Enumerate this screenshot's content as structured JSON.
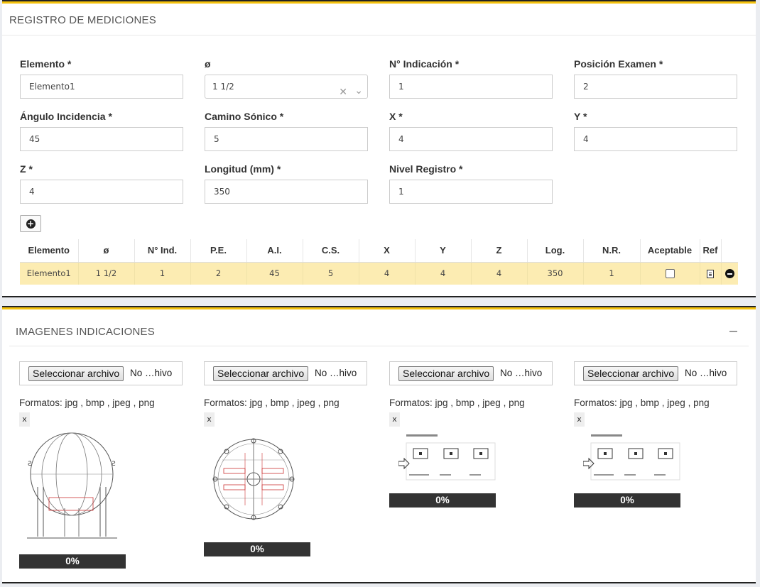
{
  "registro": {
    "title": "REGISTRO DE MEDICIONES",
    "fields": {
      "elemento": {
        "label": "Elemento *",
        "value": "Elemento1"
      },
      "diametro": {
        "label": "ø",
        "value": "1 1/2"
      },
      "n_indicacion": {
        "label": "N° Indicación *",
        "value": "1"
      },
      "posicion_examen": {
        "label": "Posición Examen *",
        "value": "2"
      },
      "angulo_incidencia": {
        "label": "Ángulo Incidencia *",
        "value": "45"
      },
      "camino_sonico": {
        "label": "Camino Sónico *",
        "value": "5"
      },
      "x": {
        "label": "X *",
        "value": "4"
      },
      "y": {
        "label": "Y *",
        "value": "4"
      },
      "z": {
        "label": "Z *",
        "value": "4"
      },
      "longitud": {
        "label": "Longitud (mm) *",
        "value": "350"
      },
      "nivel_registro": {
        "label": "Nivel Registro *",
        "value": "1"
      }
    },
    "table": {
      "headers": [
        "Elemento",
        "ø",
        "N° Ind.",
        "P.E.",
        "A.I.",
        "C.S.",
        "X",
        "Y",
        "Z",
        "Log.",
        "N.R.",
        "Aceptable",
        "Ref",
        ""
      ],
      "rows": [
        {
          "elemento": "Elemento1",
          "diametro": "1 1/2",
          "n_ind": "1",
          "pe": "2",
          "ai": "45",
          "cs": "5",
          "x": "4",
          "y": "4",
          "z": "4",
          "log": "350",
          "nr": "1",
          "aceptable": false
        }
      ]
    }
  },
  "imagenes": {
    "title": "IMAGENES INDICACIONES",
    "uploads": [
      {
        "button": "Seleccionar archivo",
        "file_text": "No …hivo",
        "formats": "Formatos: jpg , bmp , jpeg , png",
        "remove": "x",
        "progress_text": "0%",
        "progress": 0,
        "thumb": "spherical-tank-drawing"
      },
      {
        "button": "Seleccionar archivo",
        "file_text": "No …hivo",
        "formats": "Formatos: jpg , bmp , jpeg , png",
        "remove": "x",
        "progress_text": "0%",
        "progress": 0,
        "thumb": "sphere-weld-map-drawing"
      },
      {
        "button": "Seleccionar archivo",
        "file_text": "No …hivo",
        "formats": "Formatos: jpg , bmp , jpeg , png",
        "remove": "x",
        "progress_text": "0%",
        "progress": 0,
        "thumb": "products-ordered-screenshot"
      },
      {
        "button": "Seleccionar archivo",
        "file_text": "No …hivo",
        "formats": "Formatos: jpg , bmp , jpeg , png",
        "remove": "x",
        "progress_text": "0%",
        "progress": 0,
        "thumb": "products-ordered-screenshot"
      }
    ]
  },
  "colors": {
    "accent": "#f4c20d",
    "row_highlight": "#fcecb2",
    "progress_bg": "#333333"
  }
}
